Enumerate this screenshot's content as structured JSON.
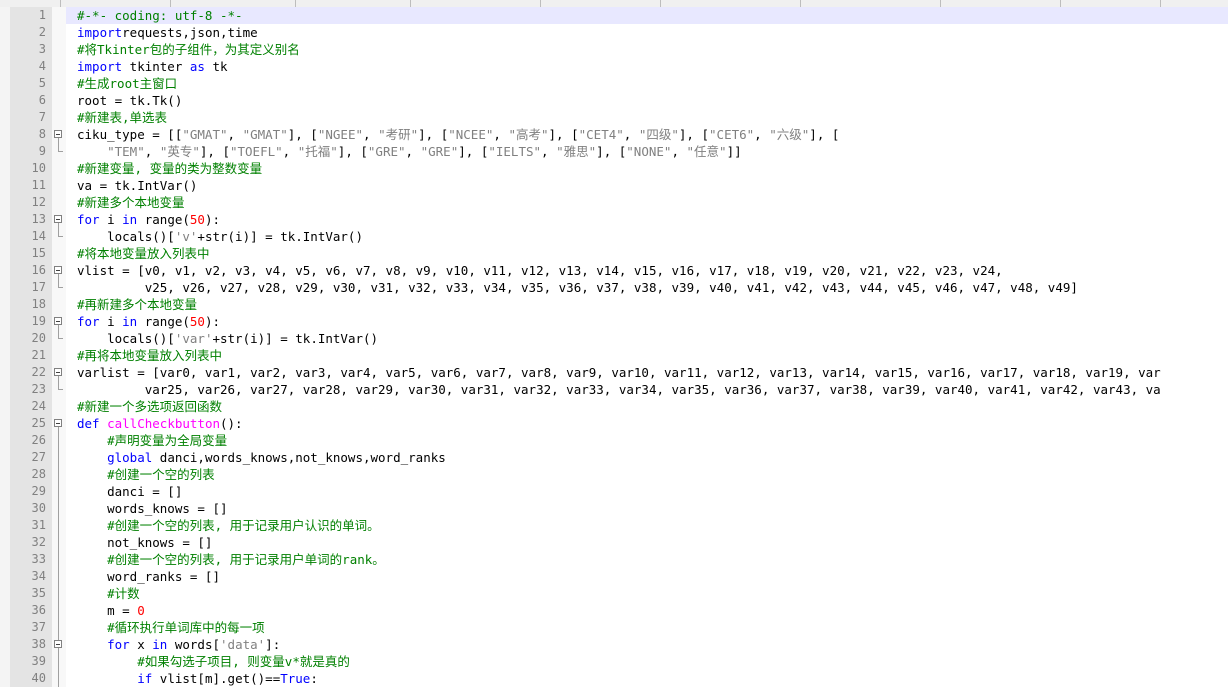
{
  "lines": [
    {
      "n": "1",
      "fold": "",
      "current": true,
      "t": [
        [
          "cm",
          "#-*- coding: utf-8 -*-"
        ]
      ]
    },
    {
      "n": "2",
      "fold": "",
      "t": [
        [
          "kw",
          "import"
        ],
        [
          "",
          "requests,json,time"
        ]
      ]
    },
    {
      "n": "3",
      "fold": "",
      "t": [
        [
          "cm",
          "#将Tkinter包的子组件，为其定义别名"
        ]
      ]
    },
    {
      "n": "4",
      "fold": "",
      "t": [
        [
          "kw",
          "import"
        ],
        [
          "",
          " tkinter "
        ],
        [
          "kw",
          "as"
        ],
        [
          "",
          " tk"
        ]
      ]
    },
    {
      "n": "5",
      "fold": "",
      "t": [
        [
          "cm",
          "#生成root主窗口"
        ]
      ]
    },
    {
      "n": "6",
      "fold": "",
      "t": [
        [
          "",
          "root = tk.Tk()"
        ]
      ]
    },
    {
      "n": "7",
      "fold": "",
      "t": [
        [
          "cm",
          "#新建表,单选表"
        ]
      ]
    },
    {
      "n": "8",
      "fold": "open",
      "t": [
        [
          "",
          "ciku_type = [["
        ],
        [
          "st",
          "\"GMAT\""
        ],
        [
          "",
          ", "
        ],
        [
          "st",
          "\"GMAT\""
        ],
        [
          "",
          "], ["
        ],
        [
          "st",
          "\"NGEE\""
        ],
        [
          "",
          ", "
        ],
        [
          "st",
          "\"考研\""
        ],
        [
          "",
          "], ["
        ],
        [
          "st",
          "\"NCEE\""
        ],
        [
          "",
          ", "
        ],
        [
          "st",
          "\"高考\""
        ],
        [
          "",
          "], ["
        ],
        [
          "st",
          "\"CET4\""
        ],
        [
          "",
          ", "
        ],
        [
          "st",
          "\"四级\""
        ],
        [
          "",
          "], ["
        ],
        [
          "st",
          "\"CET6\""
        ],
        [
          "",
          ", "
        ],
        [
          "st",
          "\"六级\""
        ],
        [
          "",
          "], ["
        ]
      ]
    },
    {
      "n": "9",
      "fold": "end",
      "t": [
        [
          "",
          "    "
        ],
        [
          "st",
          "\"TEM\""
        ],
        [
          "",
          ", "
        ],
        [
          "st",
          "\"英专\""
        ],
        [
          "",
          "], ["
        ],
        [
          "st",
          "\"TOEFL\""
        ],
        [
          "",
          ", "
        ],
        [
          "st",
          "\"托福\""
        ],
        [
          "",
          "], ["
        ],
        [
          "st",
          "\"GRE\""
        ],
        [
          "",
          ", "
        ],
        [
          "st",
          "\"GRE\""
        ],
        [
          "",
          "], ["
        ],
        [
          "st",
          "\"IELTS\""
        ],
        [
          "",
          ", "
        ],
        [
          "st",
          "\"雅思\""
        ],
        [
          "",
          "], ["
        ],
        [
          "st",
          "\"NONE\""
        ],
        [
          "",
          ", "
        ],
        [
          "st",
          "\"任意\""
        ],
        [
          "",
          "]]"
        ]
      ]
    },
    {
      "n": "10",
      "fold": "",
      "t": [
        [
          "cm",
          "#新建变量, 变量的类为整数变量"
        ]
      ]
    },
    {
      "n": "11",
      "fold": "",
      "t": [
        [
          "",
          "va = tk.IntVar()"
        ]
      ]
    },
    {
      "n": "12",
      "fold": "",
      "t": [
        [
          "cm",
          "#新建多个本地变量"
        ]
      ]
    },
    {
      "n": "13",
      "fold": "open",
      "t": [
        [
          "kw",
          "for"
        ],
        [
          "",
          " i "
        ],
        [
          "kw",
          "in"
        ],
        [
          "",
          " range("
        ],
        [
          "nm",
          "50"
        ],
        [
          "",
          "):"
        ]
      ]
    },
    {
      "n": "14",
      "fold": "end",
      "t": [
        [
          "",
          "    locals()["
        ],
        [
          "st",
          "'v'"
        ],
        [
          "",
          "+str(i)] = tk.IntVar()"
        ]
      ]
    },
    {
      "n": "15",
      "fold": "",
      "t": [
        [
          "cm",
          "#将本地变量放入列表中"
        ]
      ]
    },
    {
      "n": "16",
      "fold": "open",
      "t": [
        [
          "",
          "vlist = [v0, v1, v2, v3, v4, v5, v6, v7, v8, v9, v10, v11, v12, v13, v14, v15, v16, v17, v18, v19, v20, v21, v22, v23, v24,"
        ]
      ]
    },
    {
      "n": "17",
      "fold": "end",
      "t": [
        [
          "",
          "         v25, v26, v27, v28, v29, v30, v31, v32, v33, v34, v35, v36, v37, v38, v39, v40, v41, v42, v43, v44, v45, v46, v47, v48, v49]"
        ]
      ]
    },
    {
      "n": "18",
      "fold": "",
      "t": [
        [
          "cm",
          "#再新建多个本地变量"
        ]
      ]
    },
    {
      "n": "19",
      "fold": "open",
      "t": [
        [
          "kw",
          "for"
        ],
        [
          "",
          " i "
        ],
        [
          "kw",
          "in"
        ],
        [
          "",
          " range("
        ],
        [
          "nm",
          "50"
        ],
        [
          "",
          "):"
        ]
      ]
    },
    {
      "n": "20",
      "fold": "end",
      "t": [
        [
          "",
          "    locals()["
        ],
        [
          "st",
          "'var'"
        ],
        [
          "",
          "+str(i)] = tk.IntVar()"
        ]
      ]
    },
    {
      "n": "21",
      "fold": "",
      "t": [
        [
          "cm",
          "#再将本地变量放入列表中"
        ]
      ]
    },
    {
      "n": "22",
      "fold": "open",
      "t": [
        [
          "",
          "varlist = [var0, var1, var2, var3, var4, var5, var6, var7, var8, var9, var10, var11, var12, var13, var14, var15, var16, var17, var18, var19, var"
        ]
      ]
    },
    {
      "n": "23",
      "fold": "end",
      "t": [
        [
          "",
          "         var25, var26, var27, var28, var29, var30, var31, var32, var33, var34, var35, var36, var37, var38, var39, var40, var41, var42, var43, va"
        ]
      ]
    },
    {
      "n": "24",
      "fold": "",
      "t": [
        [
          "cm",
          "#新建一个多选项返回函数"
        ]
      ]
    },
    {
      "n": "25",
      "fold": "open",
      "t": [
        [
          "kw",
          "def"
        ],
        [
          "",
          " "
        ],
        [
          "fn",
          "callCheckbutton"
        ],
        [
          "",
          "():"
        ]
      ]
    },
    {
      "n": "26",
      "fold": "line",
      "t": [
        [
          "",
          "    "
        ],
        [
          "cm",
          "#声明变量为全局变量"
        ]
      ]
    },
    {
      "n": "27",
      "fold": "line",
      "t": [
        [
          "",
          "    "
        ],
        [
          "kw",
          "global"
        ],
        [
          "",
          " danci,words_knows,not_knows,word_ranks"
        ]
      ]
    },
    {
      "n": "28",
      "fold": "line",
      "t": [
        [
          "",
          "    "
        ],
        [
          "cm",
          "#创建一个空的列表"
        ]
      ]
    },
    {
      "n": "29",
      "fold": "line",
      "t": [
        [
          "",
          "    danci = []"
        ]
      ]
    },
    {
      "n": "30",
      "fold": "line",
      "t": [
        [
          "",
          "    words_knows = []"
        ]
      ]
    },
    {
      "n": "31",
      "fold": "line",
      "t": [
        [
          "",
          "    "
        ],
        [
          "cm",
          "#创建一个空的列表, 用于记录用户认识的单词。"
        ]
      ]
    },
    {
      "n": "32",
      "fold": "line",
      "t": [
        [
          "",
          "    not_knows = []"
        ]
      ]
    },
    {
      "n": "33",
      "fold": "line",
      "t": [
        [
          "",
          "    "
        ],
        [
          "cm",
          "#创建一个空的列表, 用于记录用户单词的rank。"
        ]
      ]
    },
    {
      "n": "34",
      "fold": "line",
      "t": [
        [
          "",
          "    word_ranks = []"
        ]
      ]
    },
    {
      "n": "35",
      "fold": "line",
      "t": [
        [
          "",
          "    "
        ],
        [
          "cm",
          "#计数"
        ]
      ]
    },
    {
      "n": "36",
      "fold": "line",
      "t": [
        [
          "",
          "    m = "
        ],
        [
          "nm",
          "0"
        ]
      ]
    },
    {
      "n": "37",
      "fold": "line",
      "t": [
        [
          "",
          "    "
        ],
        [
          "cm",
          "#循环执行单词库中的每一项"
        ]
      ]
    },
    {
      "n": "38",
      "fold": "open2",
      "t": [
        [
          "",
          "    "
        ],
        [
          "kw",
          "for"
        ],
        [
          "",
          " x "
        ],
        [
          "kw",
          "in"
        ],
        [
          "",
          " words["
        ],
        [
          "st",
          "'data'"
        ],
        [
          "",
          "]:"
        ]
      ]
    },
    {
      "n": "39",
      "fold": "line",
      "t": [
        [
          "",
          "        "
        ],
        [
          "cm",
          "#如果勾选子项目, 则变量v*就是真的"
        ]
      ]
    },
    {
      "n": "40",
      "fold": "line",
      "t": [
        [
          "",
          "        "
        ],
        [
          "kw",
          "if"
        ],
        [
          "",
          " vlist[m].get()=="
        ],
        [
          "kw",
          "True"
        ],
        [
          "",
          ":"
        ]
      ]
    }
  ],
  "colors": {
    "comment": "#008000",
    "keyword": "#0000ff",
    "string": "#808080",
    "number": "#ff0000",
    "function": "#ff00ff",
    "gutter": "#e4e4e4",
    "current_line": "#e8e8ff"
  }
}
